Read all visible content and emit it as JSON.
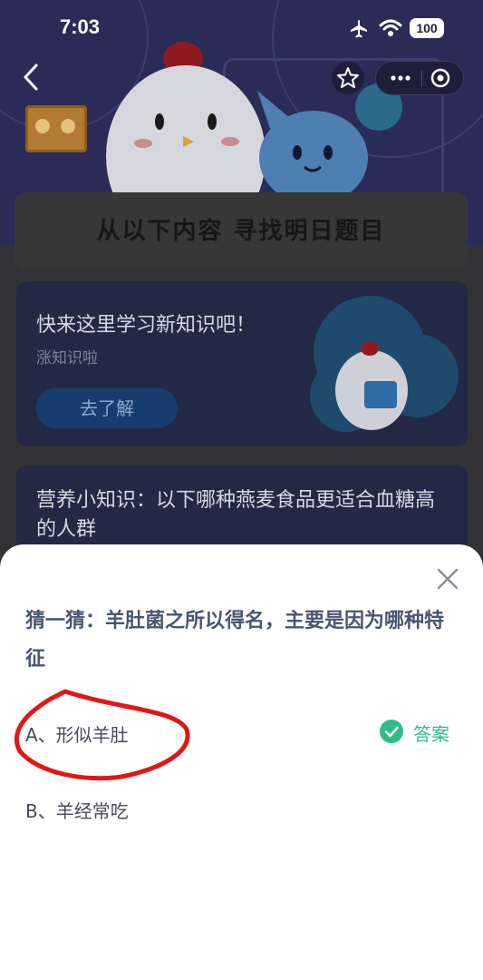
{
  "status_bar": {
    "time": "7:03",
    "battery": "100"
  },
  "search_card": {
    "title": "从以下内容 寻找明日题目"
  },
  "learn_card": {
    "title": "快来这里学习新知识吧！",
    "subtitle": "涨知识啦",
    "button_label": "去了解"
  },
  "quiz_card": {
    "question": "营养小知识：以下哪种燕麦食品更适合血糖高的人群"
  },
  "sheet": {
    "question": "猜一猜：羊肚菌之所以得名，主要是因为哪种特征",
    "options": [
      {
        "label": "A、形似羊肚"
      },
      {
        "label": "B、羊经常吃"
      }
    ],
    "answer_label": "答案"
  },
  "colors": {
    "answer_green": "#2fbd87",
    "annotation_red": "#e21616",
    "learn_button": "#173d70"
  },
  "icons": [
    "back-arrow-icon",
    "star-icon",
    "more-icon",
    "close-mini-icon",
    "airplane-icon",
    "wifi-icon",
    "close-icon",
    "check-circle-icon"
  ]
}
